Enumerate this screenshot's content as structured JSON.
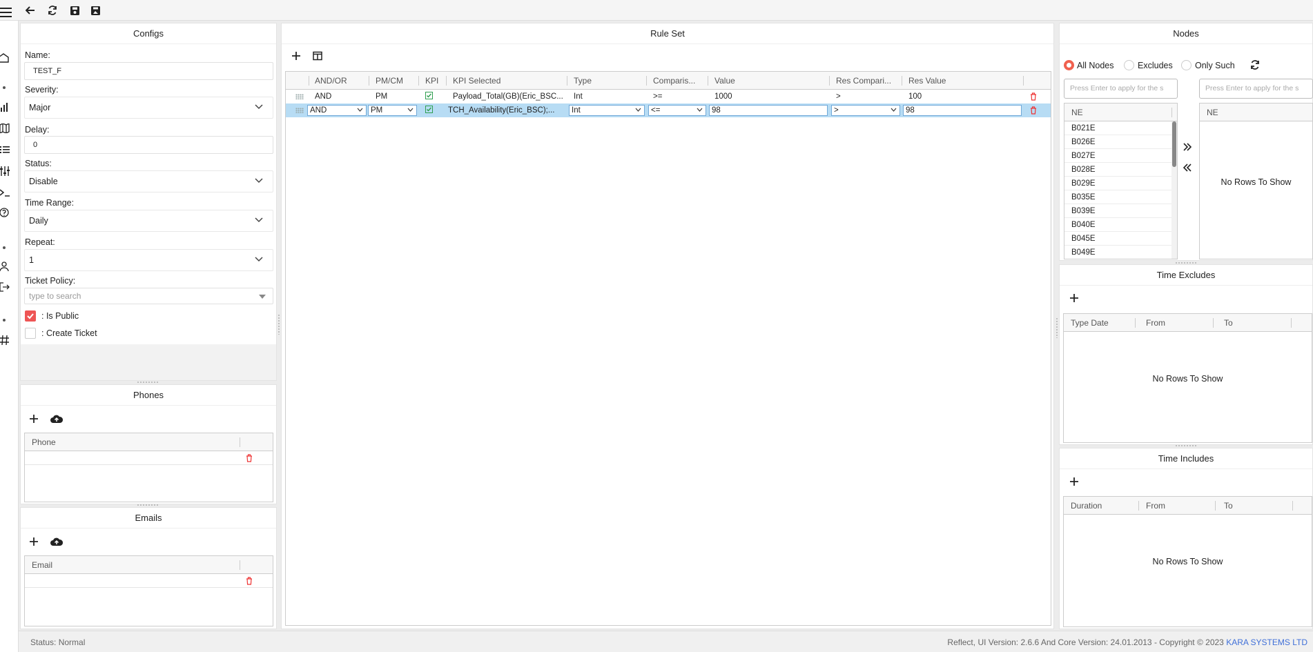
{
  "toolbar": {
    "icons": [
      "menu-icon",
      "back-arrow-icon",
      "refresh-icon",
      "save-icon",
      "save-as-icon"
    ]
  },
  "rail": {
    "icons": [
      "home-icon",
      "chart-icon",
      "map-icon",
      "list-icon",
      "sliders-icon",
      "terminal-icon",
      "help-icon",
      "user-icon",
      "logout-icon",
      "hash-icon"
    ]
  },
  "configs": {
    "title": "Configs",
    "name_label": "Name:",
    "name_value": "TEST_F",
    "severity_label": "Severity:",
    "severity_value": "Major",
    "delay_label": "Delay:",
    "delay_value": "0",
    "status_label": "Status:",
    "status_value": "Disable",
    "time_range_label": "Time Range:",
    "time_range_value": "Daily",
    "repeat_label": "Repeat:",
    "repeat_value": "1",
    "ticket_policy_label": "Ticket Policy:",
    "ticket_policy_placeholder": "type to search",
    "is_public_label": ": Is Public",
    "is_public_checked": true,
    "create_ticket_label": ": Create Ticket",
    "create_ticket_checked": false
  },
  "phones": {
    "title": "Phones",
    "column": "Phone"
  },
  "emails": {
    "title": "Emails",
    "column": "Email"
  },
  "rule_set": {
    "title": "Rule Set",
    "columns": [
      "AND/OR",
      "PM/CM",
      "KPI",
      "KPI Selected",
      "Type",
      "Comparis...",
      "Value",
      "Res Compari...",
      "Res Value"
    ],
    "rows": [
      {
        "and_or": "AND",
        "pm_cm": "PM",
        "kpi_checked": true,
        "kpi_selected": "Payload_Total(GB)(Eric_BSC...",
        "type": "Int",
        "comparison": ">=",
        "value": "1000",
        "res_comparison": ">",
        "res_value": "100"
      },
      {
        "and_or": "AND",
        "pm_cm": "PM",
        "kpi_checked": true,
        "kpi_selected": "TCH_Availability(Eric_BSC);...",
        "type": "Int",
        "comparison": "<=",
        "value": "98",
        "res_comparison": ">",
        "res_value": "98"
      }
    ]
  },
  "nodes": {
    "title": "Nodes",
    "radio_all": "All Nodes",
    "radio_excludes": "Excludes",
    "radio_only": "Only Such",
    "selected": "All Nodes",
    "filter_placeholder": "Press Enter to apply for the s",
    "column": "NE",
    "items": [
      "B021E",
      "B026E",
      "B027E",
      "B028E",
      "B029E",
      "B035E",
      "B039E",
      "B040E",
      "B045E",
      "B049E"
    ],
    "no_rows": "No Rows To Show"
  },
  "time_excludes": {
    "title": "Time Excludes",
    "columns": [
      "Type Date",
      "From",
      "To"
    ],
    "no_rows": "No Rows To Show"
  },
  "time_includes": {
    "title": "Time Includes",
    "columns": [
      "Duration",
      "From",
      "To"
    ],
    "no_rows": "No Rows To Show"
  },
  "status_bar": {
    "status": "Status: Normal",
    "version": "Reflect, UI Version: 2.6.6 And Core Version: 24.01.2013 - Copyright © 2023",
    "company": "KARA SYSTEMS LTD"
  },
  "colors": {
    "accent": "#e55050",
    "selected_row": "#b7dcf4",
    "link": "#3f6fd8"
  }
}
